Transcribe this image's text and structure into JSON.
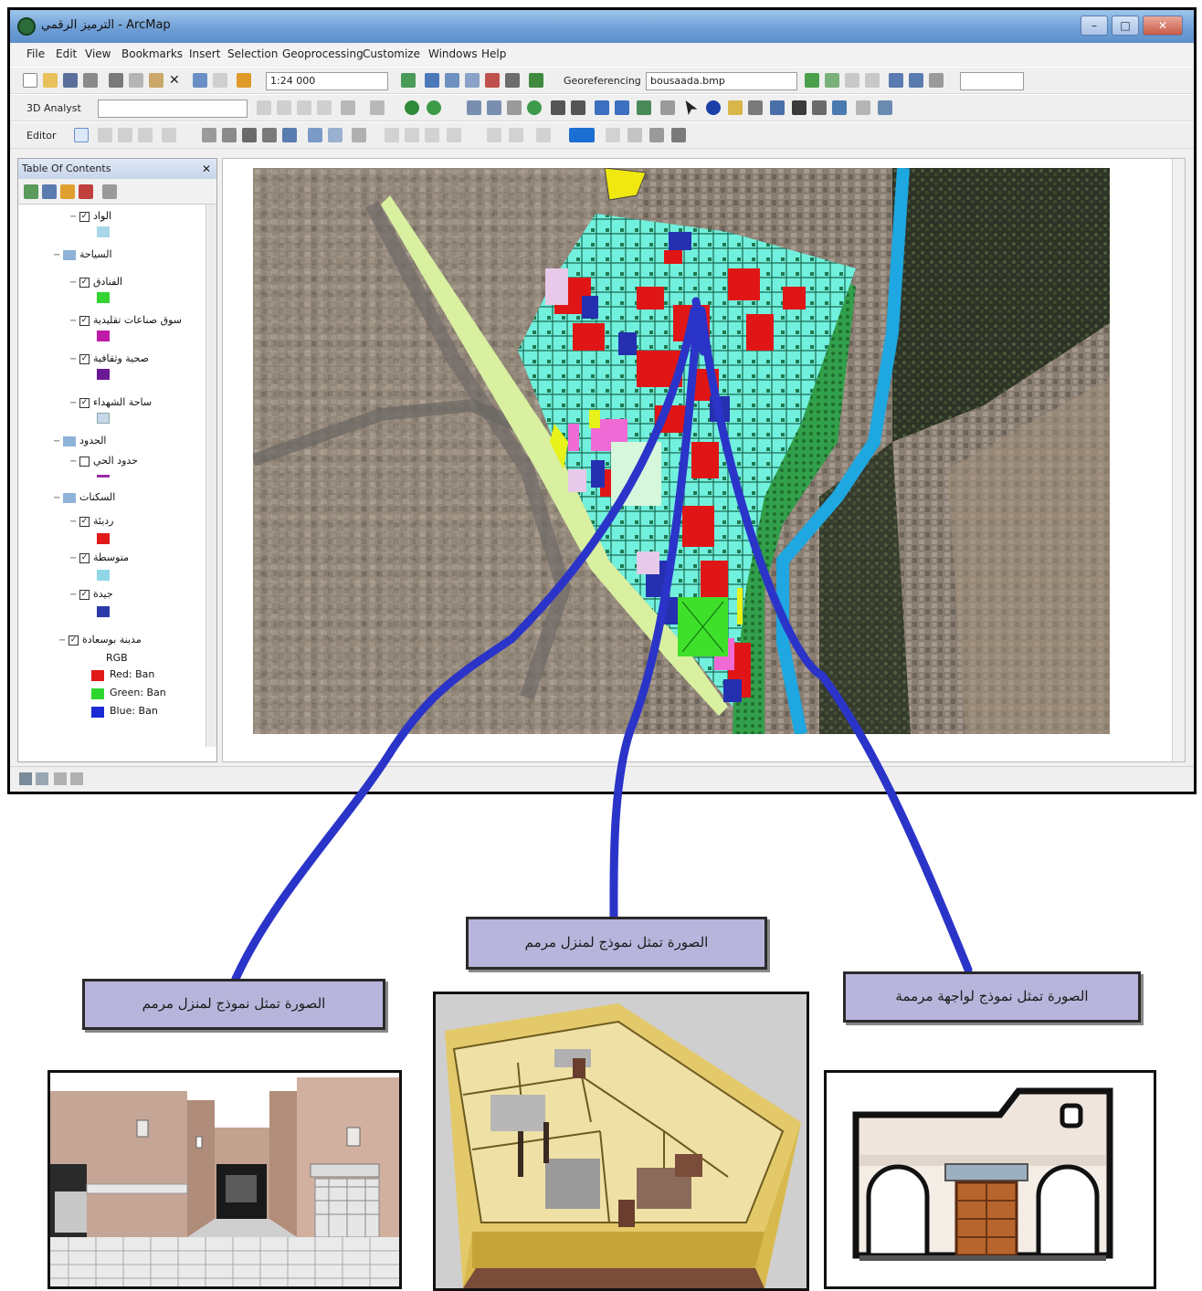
{
  "window": {
    "title": "الترميز الرقمي - ArcMap",
    "minimize": "–",
    "maximize": "□",
    "close": "✕"
  },
  "menu": [
    "File",
    "Edit",
    "View",
    "Bookmarks",
    "Insert",
    "Selection",
    "Geoprocessing",
    "Customize",
    "Windows",
    "Help"
  ],
  "toolbar": {
    "scale": "1:24 000",
    "georeferencing_label": "Georeferencing",
    "georef_layer": "bousaada.bmp",
    "analyst_label": "3D Analyst",
    "editor_label": "Editor"
  },
  "toc": {
    "title": "Table Of Contents",
    "close": "✕",
    "items": [
      {
        "label": "الواد",
        "level": 2,
        "checked": true,
        "swatch": "#a9d6e8"
      },
      {
        "label": "السياحة",
        "level": 1,
        "group": true
      },
      {
        "label": "الفنادق",
        "level": 2,
        "checked": true,
        "swatch": "#32d42f"
      },
      {
        "label": "سوق صناعات تقليدية",
        "level": 2,
        "checked": true,
        "swatch": "#c01aa8"
      },
      {
        "label": "صحية وثقافية",
        "level": 2,
        "checked": true,
        "swatch": "#6a1996"
      },
      {
        "label": "ساحة الشهداء",
        "level": 2,
        "checked": true,
        "swatch": "#c8d8ea"
      },
      {
        "label": "الحدود",
        "level": 1,
        "group": true
      },
      {
        "label": "حدود الحي",
        "level": 2,
        "checked": false,
        "swatch_line": "#9a2aa8"
      },
      {
        "label": "السكنات",
        "level": 1,
        "group": true
      },
      {
        "label": "رديئة",
        "level": 2,
        "checked": true,
        "swatch": "#e11a1a"
      },
      {
        "label": "متوسطة",
        "level": 2,
        "checked": true,
        "swatch": "#8fd6e6"
      },
      {
        "label": "جيدة",
        "level": 2,
        "checked": true,
        "swatch": "#2b3aa8"
      },
      {
        "label": "مدينة بوسعادة",
        "level": 1,
        "checked": true
      },
      {
        "label": "RGB",
        "level": 3
      },
      {
        "label": "Red:   Ban",
        "level": 3,
        "swatch": "#e11a1a"
      },
      {
        "label": "Green: Ban",
        "level": 3,
        "swatch": "#2fd62f"
      },
      {
        "label": "Blue:   Ban",
        "level": 3,
        "swatch": "#1a2ad4"
      }
    ]
  },
  "captions": {
    "left": "الصورة تمثل نموذج لمنزل مرمم",
    "center": "الصورة تمثل نموذج لمنزل مرمم",
    "right": "الصورة تمثل نموذج لواجهة مرممة"
  },
  "colors": {
    "connector": "#2b34c8",
    "caption_fill": "#b8b5dc",
    "river": "#1ea7e0",
    "cyan_blocks": "#6ff0de",
    "poor_housing": "#e01616",
    "good_housing": "#2530b0"
  }
}
